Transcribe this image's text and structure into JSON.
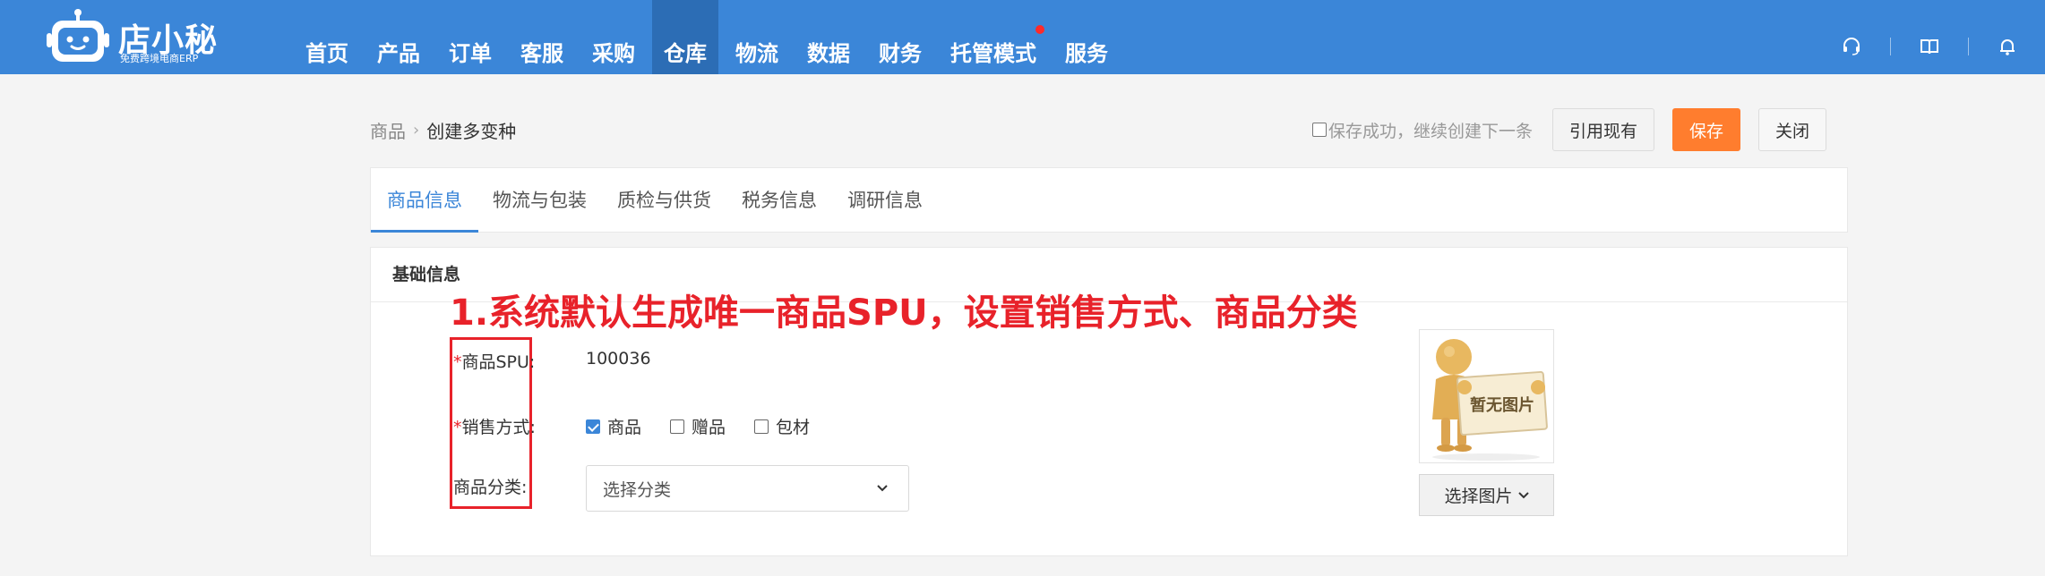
{
  "logo": {
    "name": "店小秘",
    "subtitle": "免费跨境电商ERP"
  },
  "nav": {
    "items": [
      {
        "label": "首页"
      },
      {
        "label": "产品"
      },
      {
        "label": "订单"
      },
      {
        "label": "客服"
      },
      {
        "label": "采购"
      },
      {
        "label": "仓库",
        "active": true
      },
      {
        "label": "物流"
      },
      {
        "label": "数据"
      },
      {
        "label": "财务"
      },
      {
        "label": "托管模式",
        "badge": "dot"
      },
      {
        "label": "服务"
      }
    ],
    "right_icons": [
      "headset-icon",
      "book-icon",
      "bell-icon"
    ]
  },
  "breadcrumb": {
    "parent": "商品",
    "current": "创建多变种"
  },
  "actions": {
    "continue_label": "保存成功，继续创建下一条",
    "continue_checked": false,
    "quote_label": "引用现有",
    "save_label": "保存",
    "close_label": "关闭"
  },
  "tabs": [
    {
      "label": "商品信息",
      "active": true
    },
    {
      "label": "物流与包装"
    },
    {
      "label": "质检与供货"
    },
    {
      "label": "税务信息"
    },
    {
      "label": "调研信息"
    }
  ],
  "basic_info": {
    "title": "基础信息",
    "annotation": "1.系统默认生成唯一商品SPU，设置销售方式、商品分类",
    "spu_label": "商品SPU:",
    "spu_value": "100036",
    "sale_label": "销售方式:",
    "sale_options": [
      {
        "label": "商品",
        "checked": true
      },
      {
        "label": "赠品",
        "checked": false
      },
      {
        "label": "包材",
        "checked": false
      }
    ],
    "category_label": "商品分类:",
    "category_placeholder": "选择分类",
    "image_placeholder_text": "暂无图片",
    "image_button_label": "选择图片"
  },
  "colors": {
    "nav_bg": "#3b86d8",
    "nav_active": "#2c6db5",
    "accent": "#3b86d8",
    "save": "#ff7d2e",
    "annotation": "#e8222a"
  }
}
